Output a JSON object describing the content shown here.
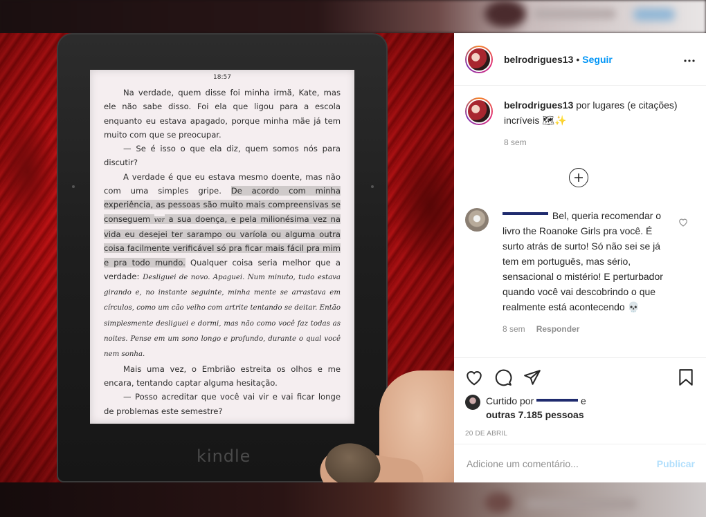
{
  "post": {
    "username": "belrodrigues13",
    "follow_label": "Seguir",
    "more_icon": "more-horizontal-icon",
    "caption_text": "por lugares (e citações) incríveis 🗺✨",
    "caption_time": "8 sem"
  },
  "photo": {
    "clock": "18:57",
    "brand": "kindle",
    "paragraphs": [
      "Na verdade, quem disse foi minha irmã, Kate, mas ele não sabe disso. Foi ela que ligou para a escola enquanto eu estava apagado, porque minha mãe já tem muito com que se preocupar.",
      "— Se é isso o que ela diz, quem somos nós para discutir?",
      "A verdade é que eu estava mesmo doente, mas não com uma simples gripe. ",
      "De acordo com minha experiência, as pessoas são muito mais compreensivas se conseguem ",
      "ver",
      " a sua doença, e pela milionésima vez na vida eu desejei ter sarampo ou varíola ou alguma outra coisa facilmente verificável só pra ficar mais fácil pra mim e pra todo mundo.",
      " Qualquer coisa seria melhor que a verdade: ",
      "Desliguei de novo. Apaguei. Num minuto, tudo estava girando e, no instante seguinte, minha mente se arrastava em círculos, como um cão velho com artrite tentando se deitar. Então simplesmente desliguei e dormi, mas não como você faz todas as noites. Pense em um sono longo e profundo, durante o qual você nem sonha.",
      "Mais uma vez, o Embrião estreita os olhos e me encara, tentando captar alguma hesitação.",
      "— Posso acreditar que você vai vir e vai ficar longe de problemas este semestre?"
    ]
  },
  "comment": {
    "text": "Bel, queria recomendar o livro the Roanoke Girls pra você. É surto atrás de surto! Só não sei se já tem em português, mas sério, sensacional o mistério! E perturbador quando você vai descobrindo o que realmente está acontecendo 💀",
    "time": "8 sem",
    "reply_label": "Responder",
    "like_icon": "heart-outline-icon"
  },
  "load_more_icon": "plus-circle-icon",
  "actions": {
    "like_icon": "heart-icon",
    "comment_icon": "comment-icon",
    "share_icon": "paper-plane-icon",
    "save_icon": "bookmark-icon",
    "liked_by_prefix": "Curtido por",
    "liked_by_suffix": "e",
    "others_count": "outras 7.185 pessoas",
    "date": "20 DE ABRIL"
  },
  "add_comment": {
    "placeholder": "Adicione um comentário...",
    "publish_label": "Publicar"
  },
  "colors": {
    "accent_blue": "#0095f6",
    "publish_disabled": "#b2dffc",
    "text": "#262626",
    "muted": "#8e8e8e"
  }
}
